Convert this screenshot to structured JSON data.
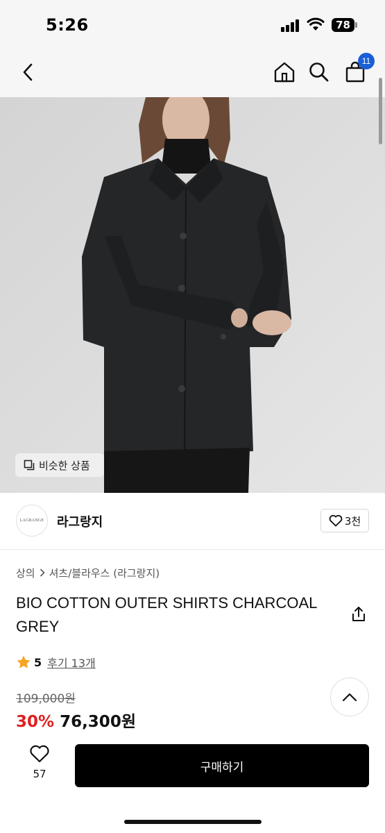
{
  "status_bar": {
    "time": "5:26",
    "battery": "78"
  },
  "header": {
    "cart_count": "11"
  },
  "image": {
    "similar_label": "비슷한 상품"
  },
  "brand": {
    "logo_text": "LAGRANGE",
    "name": "라그랑지",
    "likes": "3천"
  },
  "breadcrumb": {
    "items": [
      "상의",
      "셔츠/블라우스 (라그랑지)"
    ]
  },
  "product": {
    "title": "BIO COTTON OUTER SHIRTS CHARCOAL GREY",
    "rating": "5",
    "reviews": "후기 13개",
    "original_price": "109,000원",
    "discount": "30%",
    "sale_price": "76,300원"
  },
  "bottom_bar": {
    "like_count": "57",
    "buy_label": "구매하기"
  },
  "colors": {
    "accent": "#1a5fd6",
    "discount": "#e02020",
    "star": "#f5a623",
    "buy_button": "#000000"
  },
  "icons": [
    "back-icon",
    "home-icon",
    "search-icon",
    "cart-icon",
    "similar-icon",
    "heart-icon",
    "share-icon",
    "star-icon",
    "chevron-up-icon"
  ]
}
